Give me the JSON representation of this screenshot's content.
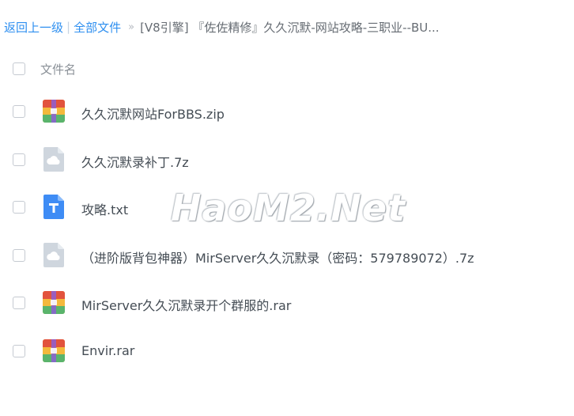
{
  "breadcrumb": {
    "back_label": "返回上一级",
    "separator": "|",
    "all_files_label": "全部文件",
    "arrow": "»",
    "current_folder": "[V8引擎] 『佐佐精修』久久沉默-网站攻略-三职业--BU..."
  },
  "list_header": {
    "filename_label": "文件名"
  },
  "files": [
    {
      "name": "久久沉默网站ForBBS.zip",
      "icon": "archive-icon"
    },
    {
      "name": "久久沉默录补丁.7z",
      "icon": "cloud-file-icon"
    },
    {
      "name": "攻略.txt",
      "icon": "text-file-icon"
    },
    {
      "name": "（进阶版背包神器）MirServer久久沉默录（密码：579789072）.7z",
      "icon": "cloud-file-icon"
    },
    {
      "name": "MirServer久久沉默录开个群服的.rar",
      "icon": "archive-icon"
    },
    {
      "name": "Envir.rar",
      "icon": "archive-icon"
    }
  ],
  "watermark": "HaoM2.Net",
  "colors": {
    "link": "#2e8ff0",
    "text": "#454d55",
    "muted": "#8a9097",
    "archive_top": "#e2533d",
    "archive_mid": "#f4b93c",
    "archive_side": "#5ab46c",
    "text_icon": "#3e8cf5",
    "cloud_icon": "#cfd6de"
  }
}
